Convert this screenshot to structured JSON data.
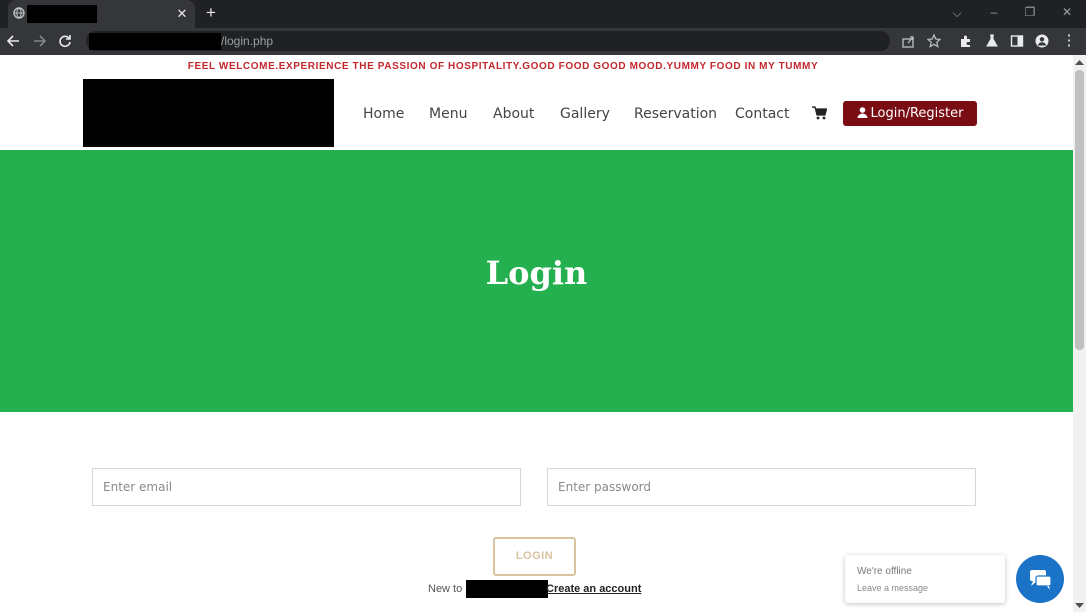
{
  "browser": {
    "tab_close": "✕",
    "new_tab": "+",
    "url_path": "/login.php",
    "win_min": "–",
    "win_restore": "❐",
    "win_close": "✕",
    "tabsearch": "⌵",
    "more_menu": "⋮"
  },
  "header": {
    "marquee": "FEEL WELCOME.EXPERIENCE THE PASSION OF HOSPITALITY.GOOD FOOD GOOD MOOD.YUMMY FOOD IN MY TUMMY",
    "nav": [
      "Home",
      "Menu",
      "About",
      "Gallery",
      "Reservation",
      "Contact"
    ],
    "login_register": "Login/Register"
  },
  "hero": {
    "title": "Login"
  },
  "form": {
    "email_placeholder": "Enter email",
    "password_placeholder": "Enter password",
    "submit_label": "LOGIN",
    "new_to": "New to",
    "create_account": "Create an account"
  },
  "chat": {
    "status": "We're offline",
    "message": "Leave a message"
  },
  "colors": {
    "hero": "#24b04e",
    "login_button": "#7a0d14",
    "marquee": "#c2272d",
    "chat": "#1a73c7"
  }
}
